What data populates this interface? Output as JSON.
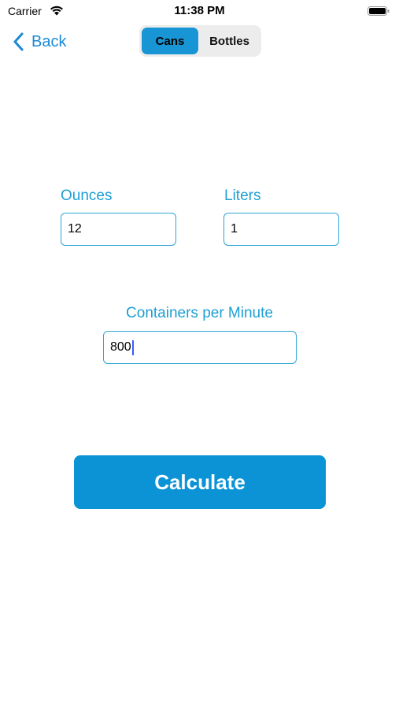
{
  "status_bar": {
    "carrier": "Carrier",
    "time": "11:38 PM",
    "wifi_icon": "wifi-icon",
    "battery_icon": "battery-icon"
  },
  "nav": {
    "back_label": "Back",
    "back_icon": "chevron-left-icon"
  },
  "segmented": {
    "items": [
      "Cans",
      "Bottles"
    ],
    "selected": "Cans"
  },
  "form": {
    "ounces": {
      "label": "Ounces",
      "value": "12"
    },
    "liters": {
      "label": "Liters",
      "value": "1"
    },
    "containers_per_minute": {
      "label": "Containers per Minute",
      "value": "800"
    }
  },
  "actions": {
    "calculate_label": "Calculate"
  },
  "colors": {
    "accent": "#1e9fd4",
    "button": "#0b93d6",
    "segment_selected": "#1895d4",
    "segment_track": "#ececed"
  }
}
